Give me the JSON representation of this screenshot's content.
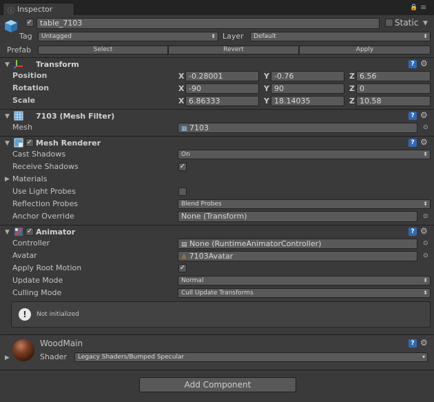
{
  "window": {
    "tab_label": "Inspector"
  },
  "object": {
    "name": "table_7103",
    "static_label": "Static",
    "tag_label": "Tag",
    "tag_value": "Untagged",
    "layer_label": "Layer",
    "layer_value": "Default",
    "prefab_label": "Prefab",
    "prefab_buttons": [
      "Select",
      "Revert",
      "Apply"
    ]
  },
  "transform": {
    "title": "Transform",
    "rows": [
      {
        "label": "Position",
        "x": "-0.28001",
        "y": "-0.76",
        "z": "6.56"
      },
      {
        "label": "Rotation",
        "x": "-90",
        "y": "90",
        "z": "0"
      },
      {
        "label": "Scale",
        "x": "6.86333",
        "y": "18.14035",
        "z": "10.58"
      }
    ],
    "axis": [
      "X",
      "Y",
      "Z"
    ]
  },
  "mesh_filter": {
    "title": "7103 (Mesh Filter)",
    "mesh_label": "Mesh",
    "mesh_value": "7103"
  },
  "mesh_renderer": {
    "title": "Mesh Renderer",
    "cast_shadows_label": "Cast Shadows",
    "cast_shadows_value": "On",
    "receive_shadows_label": "Receive Shadows",
    "materials_label": "Materials",
    "light_probes_label": "Use Light Probes",
    "reflection_probes_label": "Reflection Probes",
    "reflection_probes_value": "Blend Probes",
    "anchor_override_label": "Anchor Override",
    "anchor_override_value": "None (Transform)"
  },
  "animator": {
    "title": "Animator",
    "controller_label": "Controller",
    "controller_value": "None (RuntimeAnimatorController)",
    "avatar_label": "Avatar",
    "avatar_value": "7103Avatar",
    "root_motion_label": "Apply Root Motion",
    "update_mode_label": "Update Mode",
    "update_mode_value": "Normal",
    "culling_mode_label": "Culling Mode",
    "culling_mode_value": "Cull Update Transforms",
    "help_message": "Not initialized"
  },
  "material": {
    "name": "WoodMain",
    "shader_label": "Shader",
    "shader_value": "Legacy Shaders/Bumped Specular"
  },
  "add_component_label": "Add Component",
  "colors": {
    "background": "#3a3a3a",
    "field": "#595959",
    "help_icon": "#2e69b8"
  }
}
